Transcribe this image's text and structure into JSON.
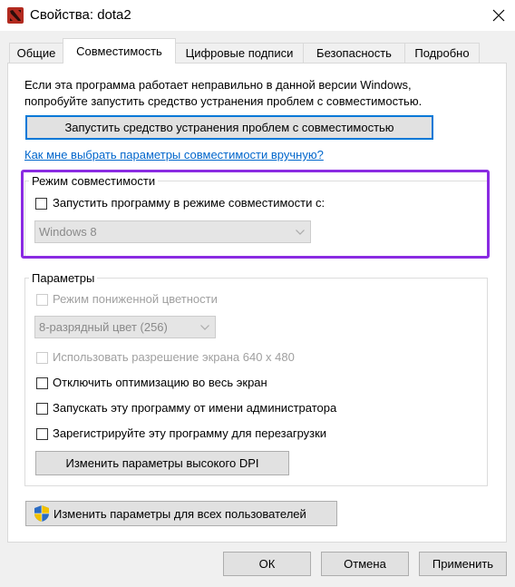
{
  "window": {
    "title": "Свойства: dota2"
  },
  "tabs": [
    {
      "label": "Общие"
    },
    {
      "label": "Совместимость"
    },
    {
      "label": "Цифровые подписи"
    },
    {
      "label": "Безопасность"
    },
    {
      "label": "Подробно"
    }
  ],
  "intro": {
    "line1": "Если эта программа работает неправильно в данной версии Windows,",
    "line2": "попробуйте запустить средство устранения проблем с совместимостью."
  },
  "troubleshoot_button": "Запустить средство устранения проблем с совместимостью",
  "manual_link": "Как мне выбрать параметры совместимости вручную?",
  "compat_mode": {
    "group_label": "Режим совместимости",
    "checkbox_label": "Запустить программу в режиме совместимости с:",
    "checked": false,
    "os_value": "Windows 8"
  },
  "params": {
    "group_label": "Параметры",
    "reduced_color": "Режим пониженной цветности",
    "color_value": "8-разрядный цвет (256)",
    "res_640": "Использовать разрешение экрана 640 x 480",
    "disable_fullscreen": "Отключить оптимизацию во весь экран",
    "run_as_admin": "Запускать эту программу от имени администратора",
    "register_restart": "Зарегистрируйте эту программу для перезагрузки",
    "dpi_button": "Изменить параметры высокого DPI"
  },
  "all_users_button": "Изменить параметры для всех пользователей",
  "footer": {
    "ok": "ОК",
    "cancel": "Отмена",
    "apply": "Применить"
  },
  "colors": {
    "accent": "#0078d7",
    "highlight": "#8a2be2",
    "link": "#0066cc"
  },
  "icons": {
    "app": "dota2-icon",
    "close": "close-icon",
    "shield": "uac-shield-icon",
    "chevron": "chevron-down-icon"
  }
}
